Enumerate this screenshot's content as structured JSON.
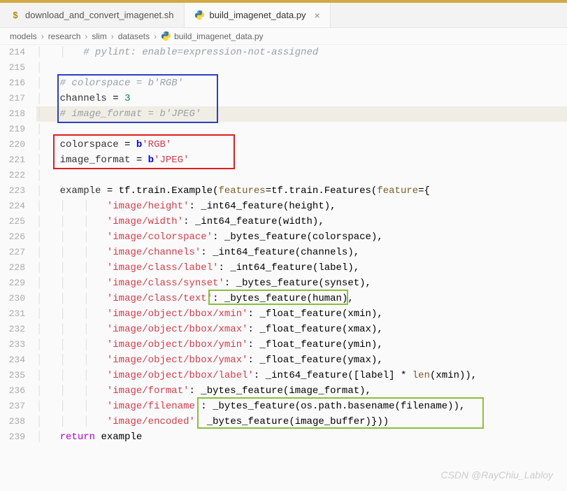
{
  "tabs": {
    "t1": {
      "label": "download_and_convert_imagenet.sh"
    },
    "t2": {
      "label": "build_imagenet_data.py",
      "close": "×"
    }
  },
  "breadcrumb": {
    "p1": "models",
    "p2": "research",
    "p3": "slim",
    "p4": "datasets",
    "p5": "build_imagenet_data.py",
    "sep": "›"
  },
  "gutter": {
    "l214": "214",
    "l215": "215",
    "l216": "216",
    "l217": "217",
    "l218": "218",
    "l219": "219",
    "l220": "220",
    "l221": "221",
    "l222": "222",
    "l223": "223",
    "l224": "224",
    "l225": "225",
    "l226": "226",
    "l227": "227",
    "l228": "228",
    "l229": "229",
    "l230": "230",
    "l231": "231",
    "l232": "232",
    "l233": "233",
    "l234": "234",
    "l235": "235",
    "l236": "236",
    "l237": "237",
    "l238": "238",
    "l239": "239"
  },
  "code": {
    "c214a": "# pylint: enable=expression-not-assigned",
    "c216a": "# colorspace = b'RGB'",
    "c217a": "channels ",
    "c217b": "=",
    "c217c": " ",
    "c217d": "3",
    "c218a": "# image_format = b'JPEG'",
    "c220a": "colorspace ",
    "c220b": "=",
    "c220c": " ",
    "c220d": "b",
    "c220e": "'RGB'",
    "c221a": "image_format ",
    "c221b": "=",
    "c221c": " ",
    "c221d": "b",
    "c221e": "'JPEG'",
    "c223a": "example ",
    "c223b": "=",
    "c223c": " tf.train.Example(",
    "c223d": "features",
    "c223e": "=tf.train.Features(",
    "c223f": "feature",
    "c223g": "={",
    "c224a": "'image/height'",
    "c224b": ": _int64_feature(height),",
    "c225a": "'image/width'",
    "c225b": ": _int64_feature(width),",
    "c226a": "'image/colorspace'",
    "c226b": ": _bytes_feature(colorspace),",
    "c227a": "'image/channels'",
    "c227b": ": _int64_feature(channels),",
    "c228a": "'image/class/label'",
    "c228b": ": _int64_feature(label),",
    "c229a": "'image/class/synset'",
    "c229b": ": _bytes_feature(synset),",
    "c230a": "'image/class/text'",
    "c230b": ": ",
    "c230c": "_bytes_feature(human),",
    "c231a": "'image/object/bbox/xmin'",
    "c231b": ": _float_feature(xmin),",
    "c232a": "'image/object/bbox/xmax'",
    "c232b": ": _float_feature(xmax),",
    "c233a": "'image/object/bbox/ymin'",
    "c233b": ": _float_feature(ymin),",
    "c234a": "'image/object/bbox/ymax'",
    "c234b": ": _float_feature(ymax),",
    "c235a": "'image/object/bbox/label'",
    "c235b": ": _int64_feature([label] * ",
    "c235c": "len",
    "c235d": "(xmin)),",
    "c236a": "'image/format'",
    "c236b": ": _bytes_feature(image_format),",
    "c237a": "'image/filename'",
    "c237b": ": ",
    "c237c": "_bytes_feature(os.path.basename(filename)),",
    "c238a": "'image/encoded'",
    "c238b": ": ",
    "c238c": "_bytes_feature(image_buffer)}))",
    "c239a": "return",
    "c239b": " example"
  },
  "watermark": "CSDN @RayChiu_Labloy",
  "icons": {
    "dollar": "$"
  }
}
